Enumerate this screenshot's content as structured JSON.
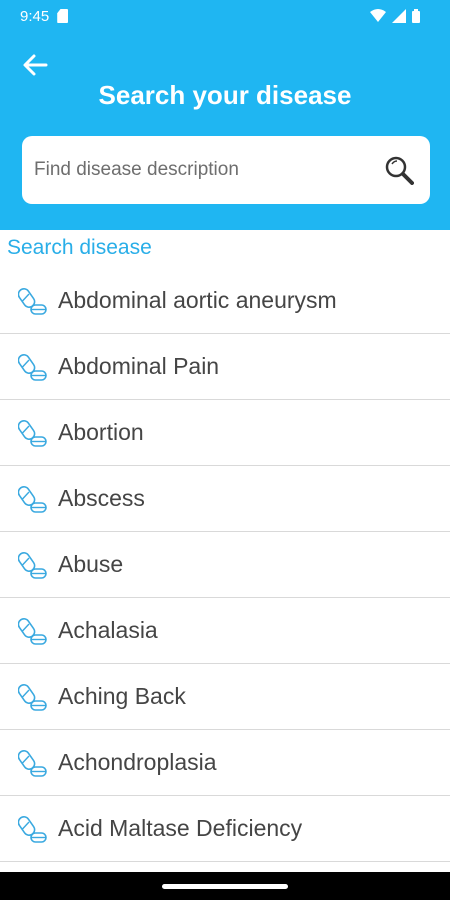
{
  "status_bar": {
    "time": "9:45"
  },
  "header": {
    "title": "Search your disease",
    "search_placeholder": "Find disease description"
  },
  "section_label": "Search disease",
  "diseases": [
    "Abdominal aortic aneurysm",
    "Abdominal Pain",
    "Abortion",
    "Abscess",
    "Abuse",
    "Achalasia",
    "Aching Back",
    "Achondroplasia",
    "Acid Maltase Deficiency"
  ],
  "colors": {
    "accent": "#1fb6f2",
    "label_blue": "#29aee8",
    "icon_blue": "#3aa9e0"
  },
  "icons": {
    "list_item": "pill-icon",
    "search": "search-icon",
    "back": "back-arrow-icon"
  }
}
